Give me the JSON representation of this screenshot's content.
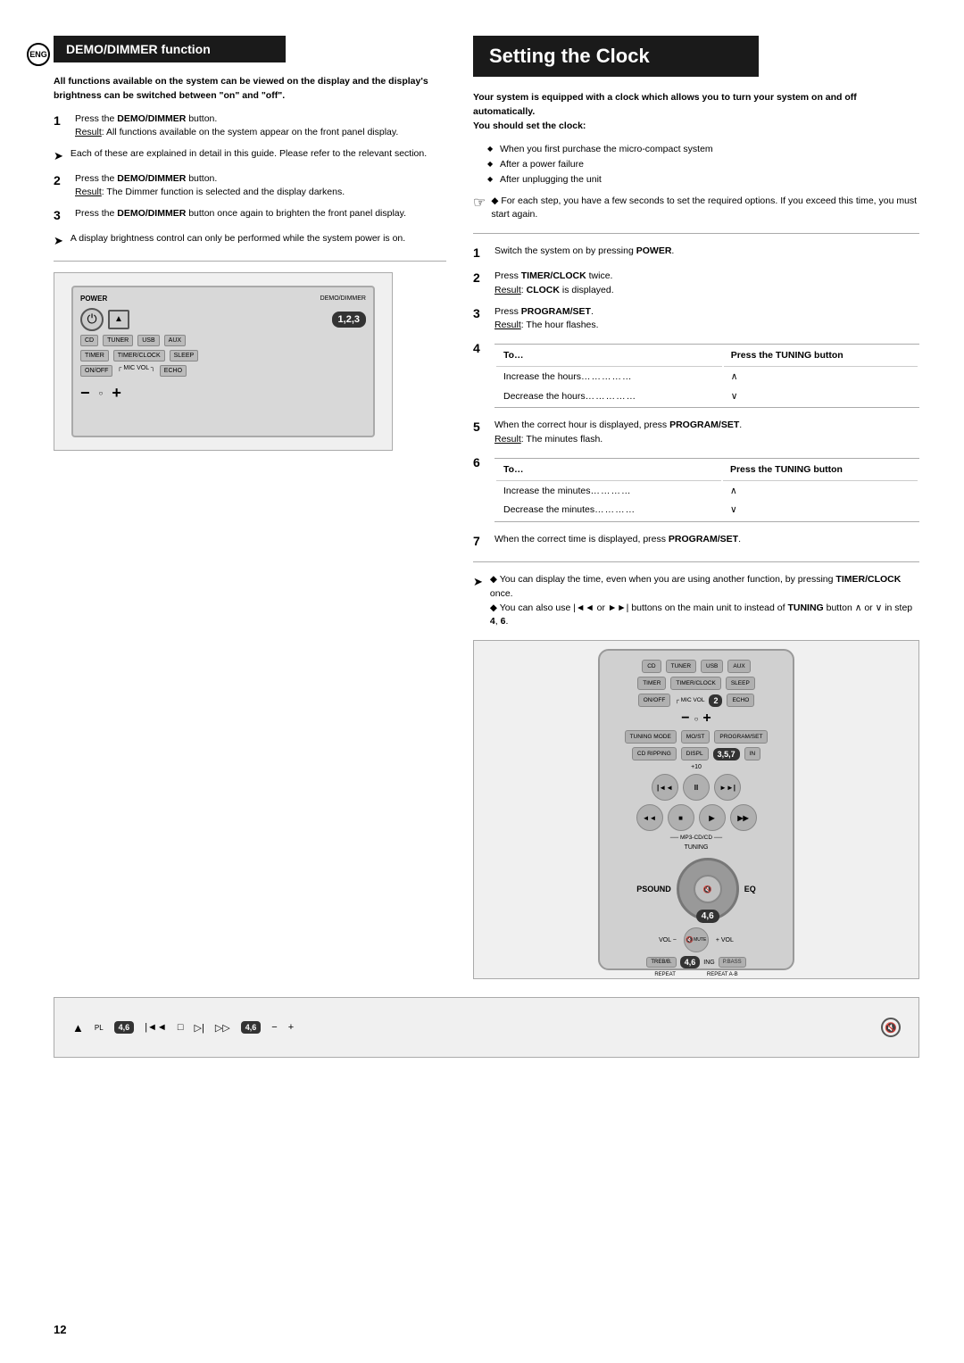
{
  "page": {
    "number": "12",
    "lang_badge": "ENG"
  },
  "left_section": {
    "title": "DEMO/DIMMER function",
    "intro": "All functions available on the system can be viewed on the display and the display's brightness can be switched between \"on\" and \"off\".",
    "steps": [
      {
        "num": "1",
        "text": "Press the DEMO/DIMMER button.",
        "result": "Result: All functions available on the system appear on the front panel display."
      },
      {
        "num": "2",
        "text": "Press the DEMO/DIMMER button.",
        "result": "Result: The Dimmer function is selected and the display darkens."
      },
      {
        "num": "3",
        "text": "Press the DEMO/DIMMER button once again to brighten the front panel display."
      }
    ],
    "arrow_note1": "Each of these are explained in detail in this guide. Please refer to the relevant section.",
    "arrow_note2": "A display brightness control can only be performed while the system power is on.",
    "device_badge": "1,2,3"
  },
  "right_section": {
    "title": "Setting the Clock",
    "intro_bold": "Your system is equipped with a clock which allows you to turn your system on and off automatically.",
    "should_set": "You should set the clock:",
    "bullet_items": [
      "When you first purchase the micro-compact system",
      "After a power failure",
      "After unplugging the unit"
    ],
    "note": "◆ For each step, you have a few seconds to set the required options. If you exceed this time, you must start again.",
    "steps": [
      {
        "num": "1",
        "text": "Switch the system on by pressing POWER."
      },
      {
        "num": "2",
        "text": "Press TIMER/CLOCK twice.",
        "result": "Result: CLOCK is displayed."
      },
      {
        "num": "3",
        "text": "Press PROGRAM/SET.",
        "result": "Result: The hour flashes."
      },
      {
        "num": "4",
        "col1": "To...",
        "col2": "Press the TUNING button",
        "rows": [
          {
            "action": "Increase the hours",
            "dots": "……………",
            "arrow": "∧"
          },
          {
            "action": "Decrease the hours",
            "dots": "……………",
            "arrow": "∨"
          }
        ]
      },
      {
        "num": "5",
        "text": "When the correct hour is displayed, press PROGRAM/SET.",
        "result": "Result: The minutes flash."
      },
      {
        "num": "6",
        "col1": "To...",
        "col2": "Press the TUNING button",
        "rows": [
          {
            "action": "Increase the minutes",
            "dots": "…………",
            "arrow": "∧"
          },
          {
            "action": "Decrease the minutes",
            "dots": "…………",
            "arrow": "∨"
          }
        ]
      },
      {
        "num": "7",
        "text": "When the correct time is displayed, press PROGRAM/SET."
      }
    ],
    "tip_notes": [
      "◆ You can display the time, even when you are using another function, by pressing TIMER/CLOCK once.",
      "◆ You can also use |◄◄ or ►►| buttons on the main unit to instead of TUNING button ∧ or ∨ in step 4, 6."
    ],
    "remote_badge": "3,5,7",
    "nav_badge": "4,6",
    "treb_badge": "4,6",
    "unit_badge1": "4,6",
    "unit_badge2": "4,6"
  }
}
